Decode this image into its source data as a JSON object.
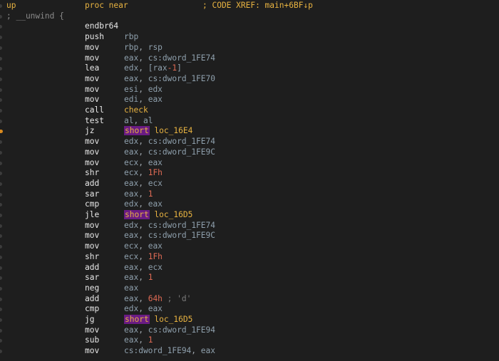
{
  "header": {
    "label": "up",
    "proc": "proc near",
    "xref": "; CODE XREF: main+6BF↓p"
  },
  "comment": "; __unwind {",
  "active_line_index": 10,
  "instructions": [
    {
      "mnemonic": "endbr64",
      "operands": []
    },
    {
      "mnemonic": "push",
      "operands": [
        {
          "t": "reg",
          "v": "rbp"
        }
      ]
    },
    {
      "mnemonic": "mov",
      "operands": [
        {
          "t": "reg",
          "v": "rbp"
        },
        {
          "t": "punct",
          "v": ", "
        },
        {
          "t": "reg",
          "v": "rsp"
        }
      ]
    },
    {
      "mnemonic": "mov",
      "operands": [
        {
          "t": "reg",
          "v": "eax"
        },
        {
          "t": "punct",
          "v": ", "
        },
        {
          "t": "reg",
          "v": "cs:dword_1FE74"
        }
      ]
    },
    {
      "mnemonic": "lea",
      "operands": [
        {
          "t": "reg",
          "v": "edx"
        },
        {
          "t": "punct",
          "v": ", "
        },
        {
          "t": "reg",
          "v": "[rax"
        },
        {
          "t": "num",
          "v": "-1"
        },
        {
          "t": "reg",
          "v": "]"
        }
      ]
    },
    {
      "mnemonic": "mov",
      "operands": [
        {
          "t": "reg",
          "v": "eax"
        },
        {
          "t": "punct",
          "v": ", "
        },
        {
          "t": "reg",
          "v": "cs:dword_1FE70"
        }
      ]
    },
    {
      "mnemonic": "mov",
      "operands": [
        {
          "t": "reg",
          "v": "esi"
        },
        {
          "t": "punct",
          "v": ", "
        },
        {
          "t": "reg",
          "v": "edx"
        }
      ]
    },
    {
      "mnemonic": "mov",
      "operands": [
        {
          "t": "reg",
          "v": "edi"
        },
        {
          "t": "punct",
          "v": ", "
        },
        {
          "t": "reg",
          "v": "eax"
        }
      ]
    },
    {
      "mnemonic": "call",
      "operands": [
        {
          "t": "func",
          "v": "check"
        }
      ]
    },
    {
      "mnemonic": "test",
      "operands": [
        {
          "t": "reg",
          "v": "al"
        },
        {
          "t": "punct",
          "v": ", "
        },
        {
          "t": "reg",
          "v": "al"
        }
      ]
    },
    {
      "mnemonic": "jz",
      "operands": [
        {
          "t": "short",
          "v": "short"
        },
        {
          "t": "punct",
          "v": " "
        },
        {
          "t": "loc",
          "v": "loc_16E4"
        }
      ]
    },
    {
      "mnemonic": "mov",
      "operands": [
        {
          "t": "reg",
          "v": "edx"
        },
        {
          "t": "punct",
          "v": ", "
        },
        {
          "t": "reg",
          "v": "cs:dword_1FE74"
        }
      ]
    },
    {
      "mnemonic": "mov",
      "operands": [
        {
          "t": "reg",
          "v": "eax"
        },
        {
          "t": "punct",
          "v": ", "
        },
        {
          "t": "reg",
          "v": "cs:dword_1FE9C"
        }
      ]
    },
    {
      "mnemonic": "mov",
      "operands": [
        {
          "t": "reg",
          "v": "ecx"
        },
        {
          "t": "punct",
          "v": ", "
        },
        {
          "t": "reg",
          "v": "eax"
        }
      ]
    },
    {
      "mnemonic": "shr",
      "operands": [
        {
          "t": "reg",
          "v": "ecx"
        },
        {
          "t": "punct",
          "v": ", "
        },
        {
          "t": "num",
          "v": "1Fh"
        }
      ]
    },
    {
      "mnemonic": "add",
      "operands": [
        {
          "t": "reg",
          "v": "eax"
        },
        {
          "t": "punct",
          "v": ", "
        },
        {
          "t": "reg",
          "v": "ecx"
        }
      ]
    },
    {
      "mnemonic": "sar",
      "operands": [
        {
          "t": "reg",
          "v": "eax"
        },
        {
          "t": "punct",
          "v": ", "
        },
        {
          "t": "num",
          "v": "1"
        }
      ]
    },
    {
      "mnemonic": "cmp",
      "operands": [
        {
          "t": "reg",
          "v": "edx"
        },
        {
          "t": "punct",
          "v": ", "
        },
        {
          "t": "reg",
          "v": "eax"
        }
      ]
    },
    {
      "mnemonic": "jle",
      "operands": [
        {
          "t": "short",
          "v": "short"
        },
        {
          "t": "punct",
          "v": " "
        },
        {
          "t": "loc",
          "v": "loc_16D5"
        }
      ]
    },
    {
      "mnemonic": "mov",
      "operands": [
        {
          "t": "reg",
          "v": "edx"
        },
        {
          "t": "punct",
          "v": ", "
        },
        {
          "t": "reg",
          "v": "cs:dword_1FE74"
        }
      ]
    },
    {
      "mnemonic": "mov",
      "operands": [
        {
          "t": "reg",
          "v": "eax"
        },
        {
          "t": "punct",
          "v": ", "
        },
        {
          "t": "reg",
          "v": "cs:dword_1FE9C"
        }
      ]
    },
    {
      "mnemonic": "mov",
      "operands": [
        {
          "t": "reg",
          "v": "ecx"
        },
        {
          "t": "punct",
          "v": ", "
        },
        {
          "t": "reg",
          "v": "eax"
        }
      ]
    },
    {
      "mnemonic": "shr",
      "operands": [
        {
          "t": "reg",
          "v": "ecx"
        },
        {
          "t": "punct",
          "v": ", "
        },
        {
          "t": "num",
          "v": "1Fh"
        }
      ]
    },
    {
      "mnemonic": "add",
      "operands": [
        {
          "t": "reg",
          "v": "eax"
        },
        {
          "t": "punct",
          "v": ", "
        },
        {
          "t": "reg",
          "v": "ecx"
        }
      ]
    },
    {
      "mnemonic": "sar",
      "operands": [
        {
          "t": "reg",
          "v": "eax"
        },
        {
          "t": "punct",
          "v": ", "
        },
        {
          "t": "num",
          "v": "1"
        }
      ]
    },
    {
      "mnemonic": "neg",
      "operands": [
        {
          "t": "reg",
          "v": "eax"
        }
      ]
    },
    {
      "mnemonic": "add",
      "operands": [
        {
          "t": "reg",
          "v": "eax"
        },
        {
          "t": "punct",
          "v": ", "
        },
        {
          "t": "num",
          "v": "64h"
        },
        {
          "t": "cmt",
          "v": " ; 'd'"
        }
      ]
    },
    {
      "mnemonic": "cmp",
      "operands": [
        {
          "t": "reg",
          "v": "edx"
        },
        {
          "t": "punct",
          "v": ", "
        },
        {
          "t": "reg",
          "v": "eax"
        }
      ]
    },
    {
      "mnemonic": "jg",
      "operands": [
        {
          "t": "short",
          "v": "short"
        },
        {
          "t": "punct",
          "v": " "
        },
        {
          "t": "loc",
          "v": "loc_16D5"
        }
      ]
    },
    {
      "mnemonic": "mov",
      "operands": [
        {
          "t": "reg",
          "v": "eax"
        },
        {
          "t": "punct",
          "v": ", "
        },
        {
          "t": "reg",
          "v": "cs:dword_1FE94"
        }
      ]
    },
    {
      "mnemonic": "sub",
      "operands": [
        {
          "t": "reg",
          "v": "eax"
        },
        {
          "t": "punct",
          "v": ", "
        },
        {
          "t": "num",
          "v": "1"
        }
      ]
    },
    {
      "mnemonic": "mov",
      "operands": [
        {
          "t": "reg",
          "v": "cs:dword_1FE94"
        },
        {
          "t": "punct",
          "v": ", "
        },
        {
          "t": "reg",
          "v": "eax"
        }
      ]
    }
  ]
}
